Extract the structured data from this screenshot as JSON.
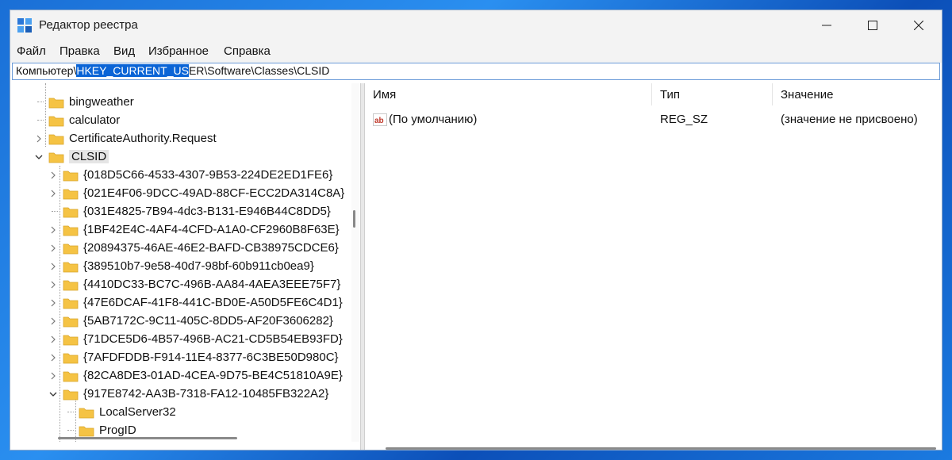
{
  "window": {
    "title": "Редактор реестра"
  },
  "menu": [
    "Файл",
    "Правка",
    "Вид",
    "Избранное",
    "Справка"
  ],
  "address": {
    "prefix": "Компьютер\\",
    "selected": "HKEY_CURRENT_US",
    "suffix": "ER\\Software\\Classes\\CLSID"
  },
  "tree": {
    "items": [
      {
        "label": "bingweather",
        "level": 0,
        "expander": "none"
      },
      {
        "label": "calculator",
        "level": 0,
        "expander": "none"
      },
      {
        "label": "CertificateAuthority.Request",
        "level": 0,
        "expander": "collapsed"
      },
      {
        "label": "CLSID",
        "level": 0,
        "expander": "expanded",
        "selected": true
      },
      {
        "label": "{018D5C66-4533-4307-9B53-224DE2ED1FE6}",
        "level": 1,
        "expander": "collapsed"
      },
      {
        "label": "{021E4F06-9DCC-49AD-88CF-ECC2DA314C8A}",
        "level": 1,
        "expander": "collapsed"
      },
      {
        "label": "{031E4825-7B94-4dc3-B131-E946B44C8DD5}",
        "level": 1,
        "expander": "none"
      },
      {
        "label": "{1BF42E4C-4AF4-4CFD-A1A0-CF2960B8F63E}",
        "level": 1,
        "expander": "collapsed"
      },
      {
        "label": "{20894375-46AE-46E2-BAFD-CB38975CDCE6}",
        "level": 1,
        "expander": "collapsed"
      },
      {
        "label": "{389510b7-9e58-40d7-98bf-60b911cb0ea9}",
        "level": 1,
        "expander": "collapsed"
      },
      {
        "label": "{4410DC33-BC7C-496B-AA84-4AEA3EEE75F7}",
        "level": 1,
        "expander": "collapsed"
      },
      {
        "label": "{47E6DCAF-41F8-441C-BD0E-A50D5FE6C4D1}",
        "level": 1,
        "expander": "collapsed"
      },
      {
        "label": "{5AB7172C-9C11-405C-8DD5-AF20F3606282}",
        "level": 1,
        "expander": "collapsed"
      },
      {
        "label": "{71DCE5D6-4B57-496B-AC21-CD5B54EB93FD}",
        "level": 1,
        "expander": "collapsed"
      },
      {
        "label": "{7AFDFDDB-F914-11E4-8377-6C3BE50D980C}",
        "level": 1,
        "expander": "collapsed"
      },
      {
        "label": "{82CA8DE3-01AD-4CEA-9D75-BE4C51810A9E}",
        "level": 1,
        "expander": "collapsed"
      },
      {
        "label": "{917E8742-AA3B-7318-FA12-10485FB322A2}",
        "level": 1,
        "expander": "expanded"
      },
      {
        "label": "LocalServer32",
        "level": 2,
        "expander": "none"
      },
      {
        "label": "ProgID",
        "level": 2,
        "expander": "none"
      }
    ]
  },
  "values": {
    "columns": [
      "Имя",
      "Тип",
      "Значение"
    ],
    "rows": [
      {
        "icon": "string-value-icon",
        "name": "(По умолчанию)",
        "type": "REG_SZ",
        "data": "(значение не присвоено)"
      }
    ]
  },
  "colors": {
    "folder": "#f5c344",
    "selection": "#0a64d6"
  }
}
